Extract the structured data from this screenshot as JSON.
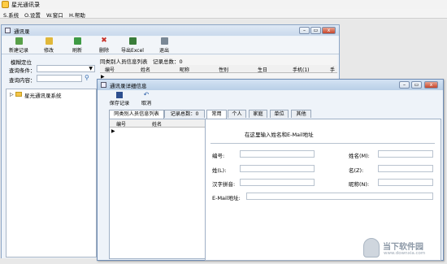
{
  "app": {
    "title": "星光通讯录"
  },
  "menu": [
    {
      "label": "S.系统"
    },
    {
      "label": "O.设置"
    },
    {
      "label": "W.窗口"
    },
    {
      "label": "H.帮助"
    }
  ],
  "window1": {
    "title": "通讯录",
    "toolbar": [
      {
        "label": "新建记录",
        "icon": "new-record-icon",
        "color": "#58a048"
      },
      {
        "label": "修改",
        "icon": "edit-icon",
        "color": "#e1b83a"
      },
      {
        "label": "刷新",
        "icon": "refresh-icon",
        "color": "#3e9a44"
      },
      {
        "label": "删除",
        "icon": "delete-icon",
        "color": "#c8312a"
      },
      {
        "label": "导出Excel",
        "icon": "excel-export-icon",
        "color": "#3a7d3a"
      },
      {
        "label": "退出",
        "icon": "exit-icon",
        "color": "#7a8896"
      }
    ],
    "search": {
      "heading": "模糊定位",
      "condition_label": "查询条件：",
      "content_label": "查询内容："
    },
    "tree_root": "星光通讯录系统",
    "list": {
      "title": "同类别人员信息列表",
      "count_label": "记录总数：0",
      "columns": [
        "编号",
        "姓名",
        "昵称",
        "性别",
        "生日",
        "手机(1)",
        "手"
      ]
    }
  },
  "window2": {
    "title": "通讯录详细信息",
    "save_label": "保存记录",
    "cancel_label": "取消",
    "left_tabs": [
      {
        "label": "同类别人员信息列表"
      },
      {
        "label": "记录总数：0"
      }
    ],
    "left_columns": [
      "编号",
      "姓名"
    ],
    "tabs": [
      "常用",
      "个人",
      "家庭",
      "单位",
      "其他"
    ],
    "hint": "在这里输入姓名和E-Mail地址",
    "fields": {
      "number": "编号:",
      "name": "姓名(M):",
      "surname": "姓(L):",
      "given": "名(Z):",
      "pinyin": "汉字拼音:",
      "nickname": "昵称(N):",
      "email": "E-Mail地址:"
    }
  },
  "watermark": {
    "text": "当下软件园",
    "url": "www.downxia.com"
  }
}
